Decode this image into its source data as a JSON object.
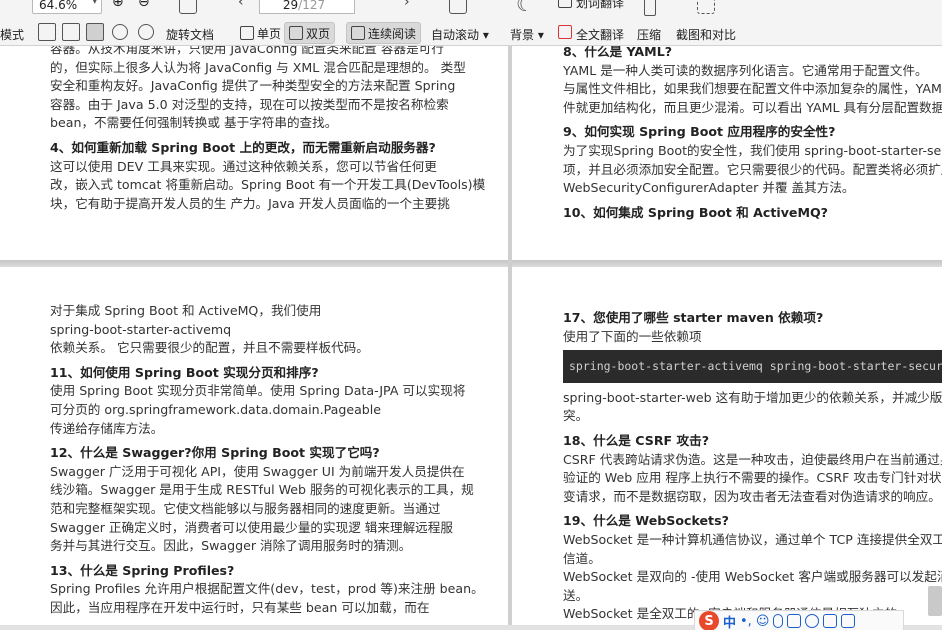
{
  "toolbar": {
    "mode_label_left": "模式",
    "zoom": "64.6%",
    "rotate_label": "旋转文档",
    "page_current": "29",
    "page_total": "/127",
    "single_page": "单页",
    "double_page": "双页",
    "continuous": "连续阅读",
    "auto_scroll": "自动滚动",
    "background": "背景",
    "word_translate": "划词翻译",
    "full_translate": "全文翻译",
    "compress": "压缩",
    "screenshot_compare": "截图和对比"
  },
  "page_tl": {
    "lines": [
      "容器。从技术角度来讲，只使用 JavaConfig 配置类来配置 容器是可行",
      "的，但实际上很多人认为将 JavaConfig 与 XML 混合匹配是理想的。 类型",
      "安全和重构友好。JavaConfig 提供了一种类型安全的方法来配置 Spring",
      "容器。由于 Java 5.0 对泛型的支持，现在可以按类型而不是按名称检索",
      "bean，不需要任何强制转换或 基于字符串的查找。"
    ],
    "heading4": "4、如何重新加载 Spring Boot 上的更改，而无需重新启动服务器?",
    "lines4": [
      "这可以使用 DEV 工具来实现。通过这种依赖关系，您可以节省任何更",
      "改，嵌入式 tomcat 将重新启动。Spring Boot 有一个开发工具(DevTools)模",
      "块，它有助于提高开发人员的生 产力。Java 开发人员面临的一个主要挑"
    ]
  },
  "page_tr": {
    "heading8": "8、什么是 YAML?",
    "lines8": [
      "YAML 是一种人类可读的数据序列化语言。它通常用于配置文件。",
      "与属性文件相比，如果我们想要在配置文件中添加复杂的属性，YAML",
      "件就更加结构化，而且更少混淆。可以看出 YAML 具有分层配置数据。"
    ],
    "heading9": "9、如何实现 Spring Boot 应用程序的安全性?",
    "lines9": [
      "为了实现Spring Boot的安全性，我们使用 spring-boot-starter-security依",
      "项，并且必须添加安全配置。它只需要很少的代码。配置类将必须扩展",
      "WebSecurityConfigurerAdapter 并覆 盖其方法。"
    ],
    "heading10": "10、如何集成 Spring Boot 和 ActiveMQ?"
  },
  "page_bl": {
    "lines": [
      "对于集成 Spring Boot 和 ActiveMQ，我们使用",
      "spring-boot-starter-activemq",
      "依赖关系。 它只需要很少的配置，并且不需要样板代码。"
    ],
    "heading11": "11、如何使用 Spring Boot 实现分页和排序?",
    "lines11": [
      "使用 Spring Boot 实现分页非常简单。使用 Spring Data-JPA 可以实现将",
      "可分页的 org.springframework.data.domain.Pageable",
      "传递给存储库方法。"
    ],
    "heading12": "12、什么是 Swagger?你用 Spring Boot 实现了它吗?",
    "lines12": [
      "Swagger 广泛用于可视化 API，使用 Swagger UI 为前端开发人员提供在",
      "线沙箱。Swagger 是用于生成 RESTful Web 服务的可视化表示的工具，规",
      "范和完整框架实现。它使文档能够以与服务器相同的速度更新。当通过",
      "Swagger 正确定义时，消费者可以使用最少量的实现逻 辑来理解远程服",
      "务并与其进行交互。因此，Swagger 消除了调用服务时的猜测。"
    ],
    "heading13": "13、什么是 Spring Profiles?",
    "lines13": [
      "Spring Profiles 允许用户根据配置文件(dev，test，prod 等)来注册 bean。",
      "因此，当应用程序在开发中运行时，只有某些 bean 可以加载，而在"
    ]
  },
  "page_br": {
    "heading17": "17、您使用了哪些 starter maven 依赖项?",
    "line17": "使用了下面的一些依赖项",
    "code": "spring-boot-starter-activemq spring-boot-starter-security",
    "lines17b": [
      "spring-boot-starter-web 这有助于增加更少的依赖关系，并减少版本的",
      "突。"
    ],
    "heading18": "18、什么是 CSRF 攻击?",
    "lines18": [
      "CSRF 代表跨站请求伪造。这是一种攻击，迫使最终用户在当前通过身",
      "验证的 Web 应用 程序上执行不需要的操作。CSRF 攻击专门针对状态",
      "变请求，而不是数据窃取，因为攻击者无法查看对伪造请求的响应。"
    ],
    "heading19": "19、什么是 WebSockets?",
    "lines19": [
      "WebSocket 是一种计算机通信协议，通过单个 TCP 连接提供全双工通",
      "信道。",
      "WebSocket 是双向的 -使用 WebSocket 客户端或服务器可以发起消息",
      "送。",
      "WebSocket 是全双工的 -客户端和服务器通信是相互独立的。"
    ]
  },
  "ime": {
    "lang": "中"
  }
}
